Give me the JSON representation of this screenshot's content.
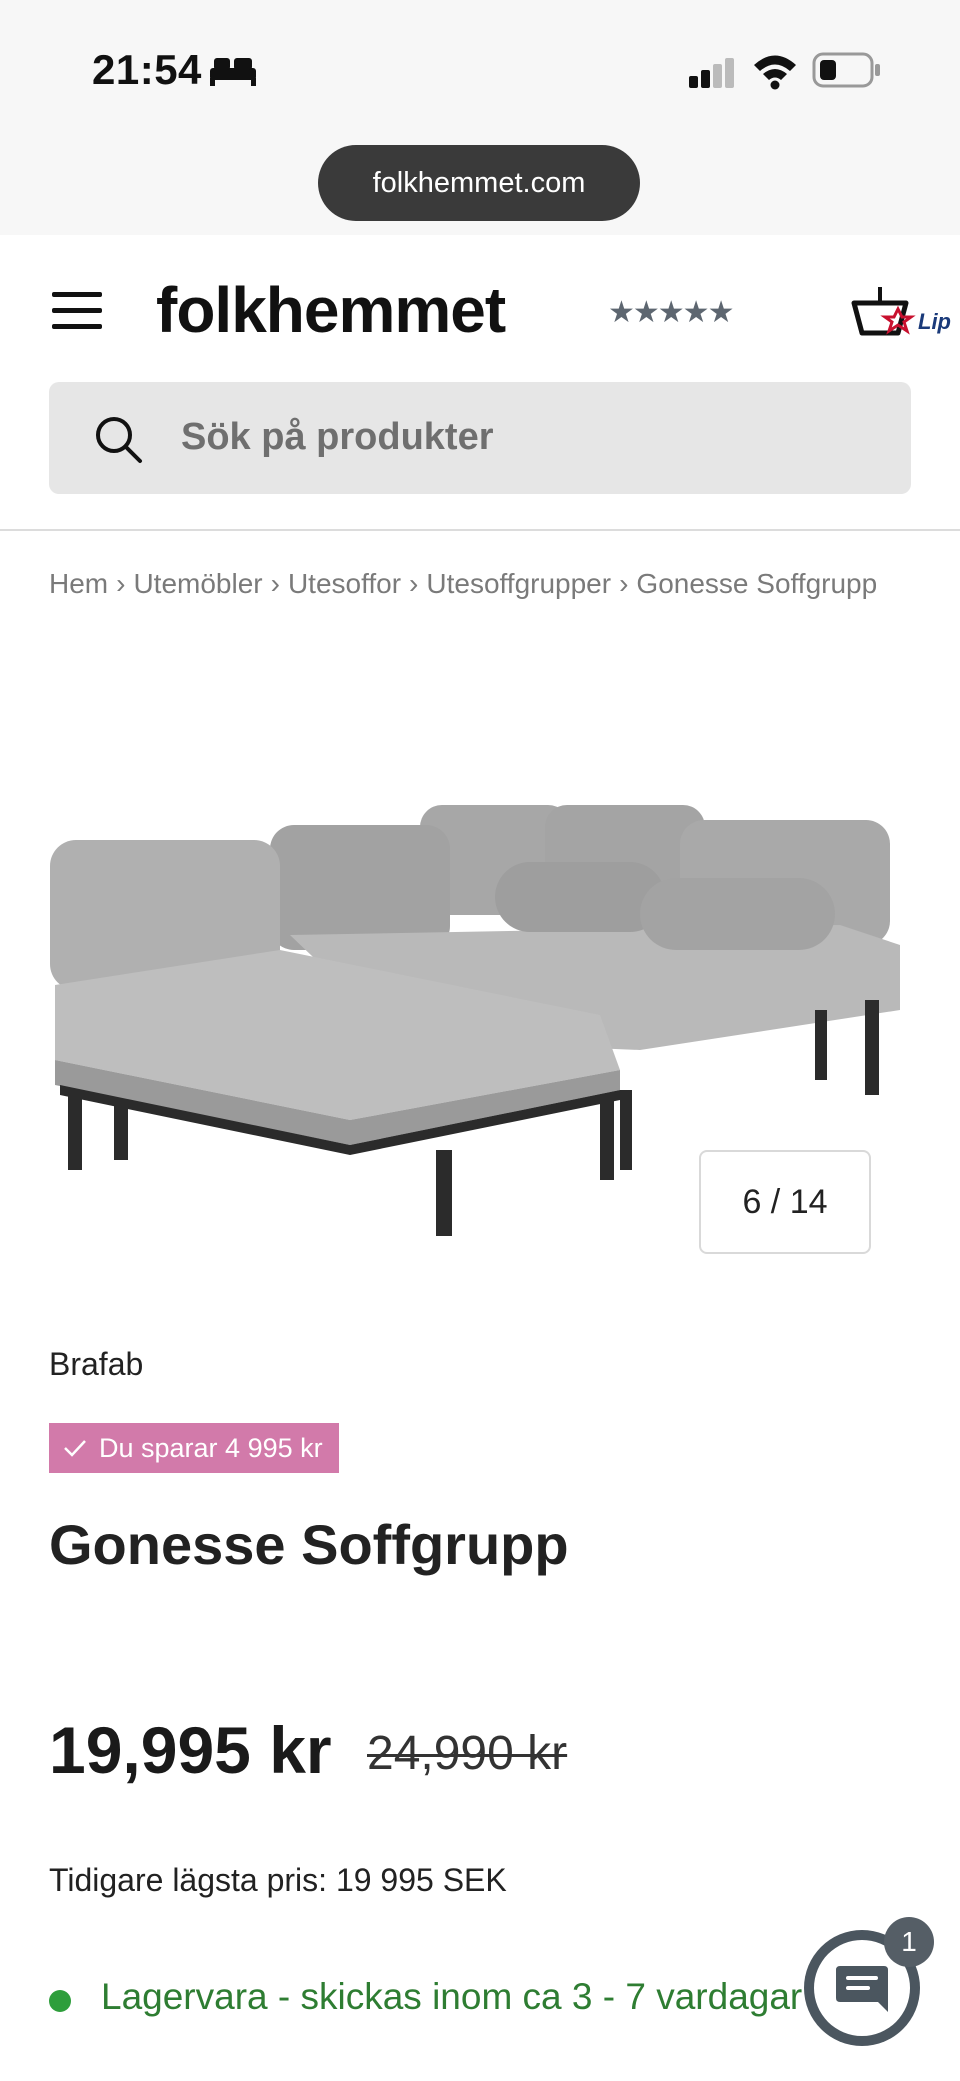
{
  "status_bar": {
    "time": "21:54"
  },
  "browser": {
    "url": "folkhemmet.com"
  },
  "header": {
    "logo": "folkhemmet",
    "rating_stars": "★★★★★",
    "search_placeholder": "Sök på produkter"
  },
  "breadcrumb": [
    "Hem",
    "Utemöbler",
    "Utesoffor",
    "Utesoffgrupper",
    "Gonesse Soffgrupp"
  ],
  "breadcrumb_separator": "›",
  "gallery": {
    "counter": "6 / 14"
  },
  "product": {
    "brand": "Brafab",
    "badge": "Du sparar 4 995 kr",
    "name": "Gonesse Soffgrupp",
    "price": "19,995 kr",
    "old_price": "24,990 kr",
    "lowest_price": "Tidigare lägsta pris: 19 995 SEK",
    "stock": "Lagervara - skickas inom ca 3 - 7 vardagar"
  },
  "chat": {
    "badge_count": "1"
  },
  "colors": {
    "badge": "#d27aaa",
    "stock": "#2e7d32",
    "chat": "#4b565f"
  }
}
